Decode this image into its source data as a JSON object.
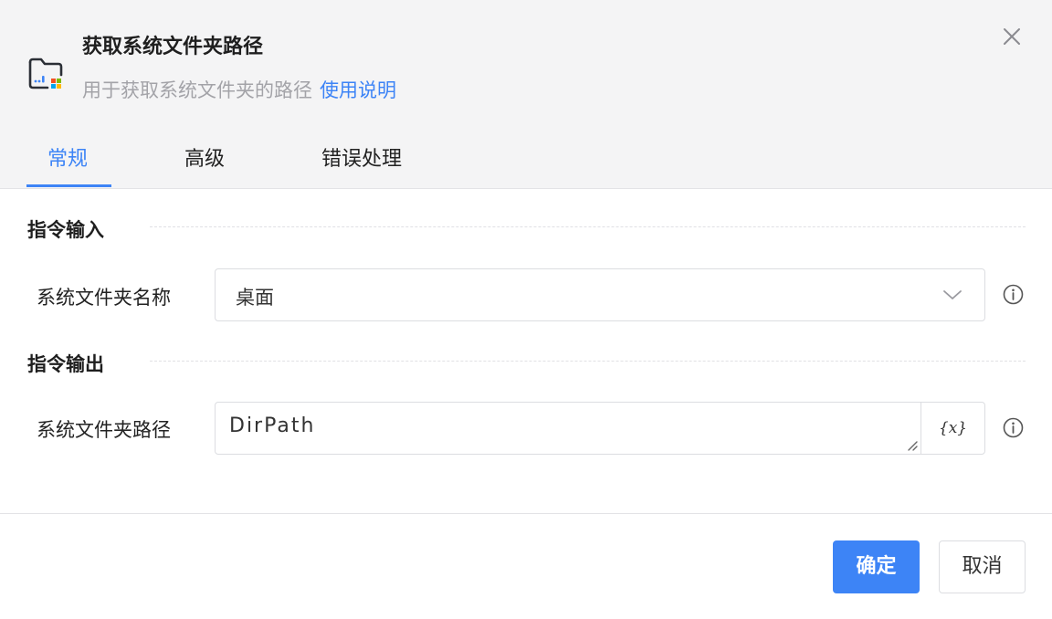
{
  "dialog": {
    "title": "获取系统文件夹路径",
    "description": "用于获取系统文件夹的路径",
    "help_link": "使用说明",
    "icon": "folder-windows-icon",
    "close_icon": "close-icon"
  },
  "tabs": [
    {
      "label": "常规",
      "active": true
    },
    {
      "label": "高级",
      "active": false
    },
    {
      "label": "错误处理",
      "active": false
    }
  ],
  "input_section": {
    "title": "指令输入",
    "fields": [
      {
        "label": "系统文件夹名称",
        "value": "桌面",
        "type": "select"
      }
    ]
  },
  "output_section": {
    "title": "指令输出",
    "fields": [
      {
        "label": "系统文件夹路径",
        "value": "DirPath",
        "type": "variable",
        "var_button": "{x}"
      }
    ]
  },
  "footer": {
    "confirm": "确定",
    "cancel": "取消"
  },
  "colors": {
    "accent": "#3d84f6",
    "header_bg": "#f4f4f5",
    "muted_text": "#a3a3a8"
  }
}
